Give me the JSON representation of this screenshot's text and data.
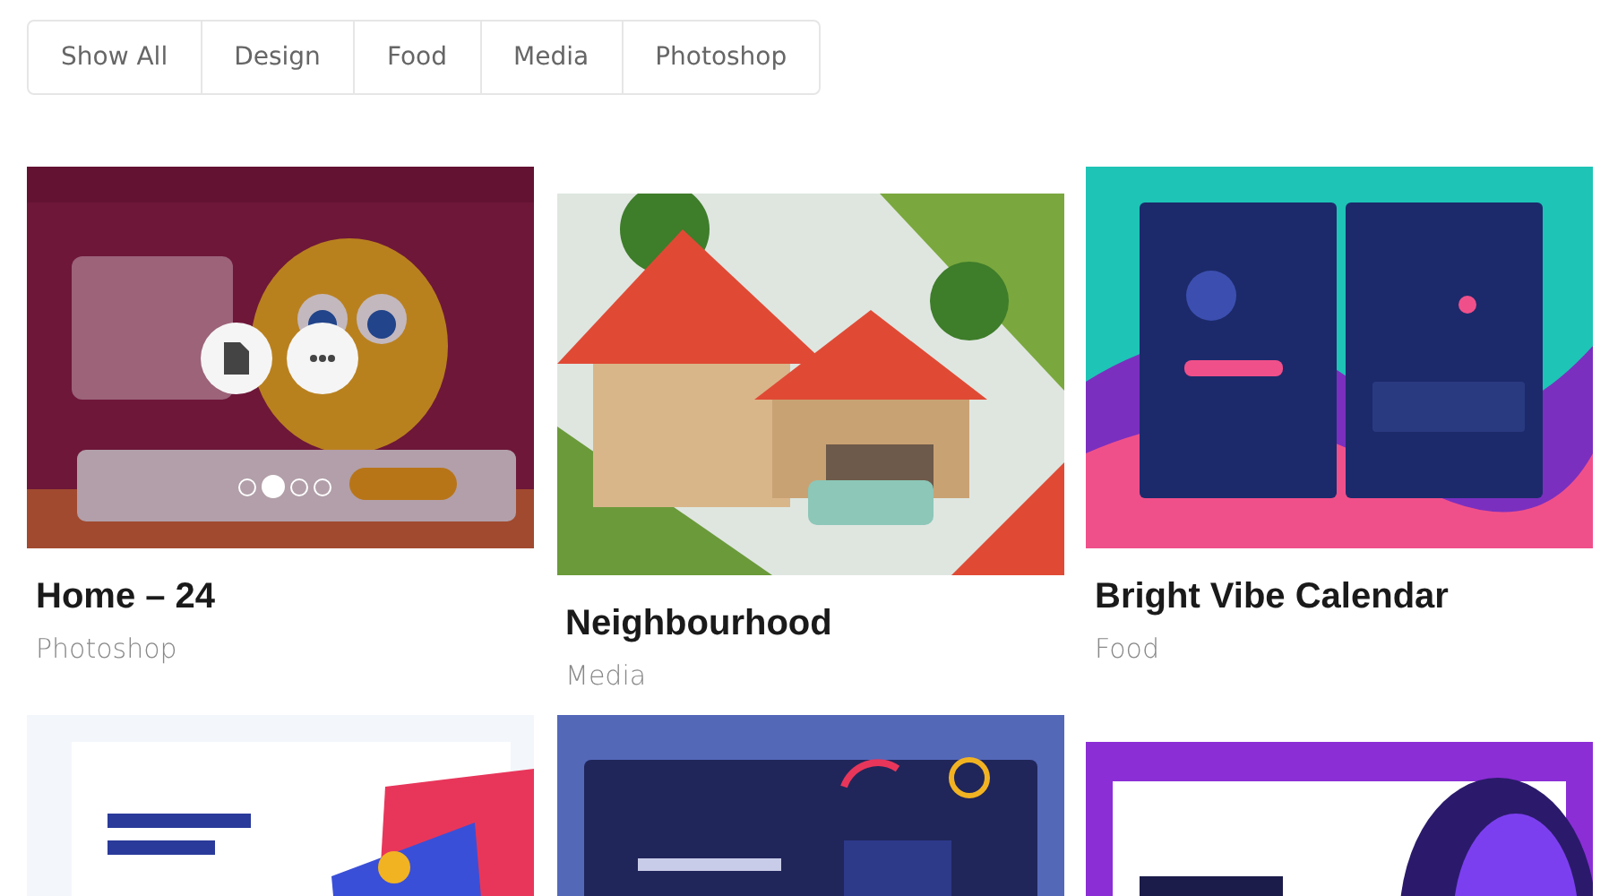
{
  "filters": [
    {
      "label": "Show All",
      "selected": false
    },
    {
      "label": "Design",
      "selected": false
    },
    {
      "label": "Food",
      "selected": false
    },
    {
      "label": "Media",
      "selected": false
    },
    {
      "label": "Photoshop",
      "selected": false
    }
  ],
  "items": [
    {
      "kind": "project",
      "title": "Home – 24",
      "category": "Photoshop",
      "hovered": true,
      "dots": [
        {
          "selected": false
        },
        {
          "selected": true
        },
        {
          "selected": false
        },
        {
          "selected": false
        }
      ]
    },
    {
      "kind": "project",
      "title": "Neighbourhood",
      "category": "Media"
    },
    {
      "kind": "project",
      "title": "Bright Vibe Calendar",
      "category": "Food"
    },
    {
      "kind": "picture"
    },
    {
      "kind": "picture"
    },
    {
      "kind": "picture"
    }
  ]
}
